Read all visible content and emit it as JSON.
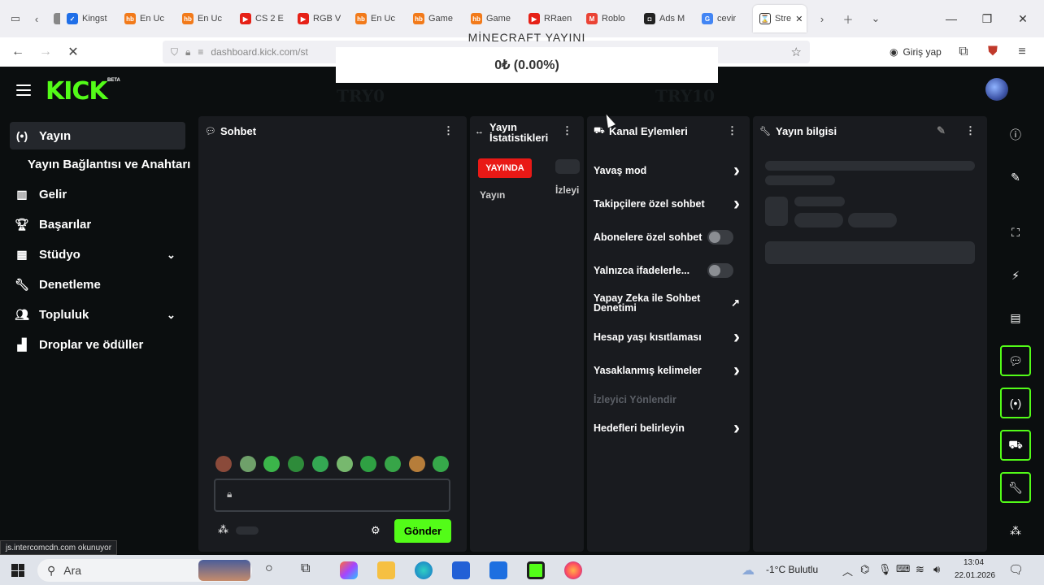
{
  "browser": {
    "tabs": [
      {
        "label": "",
        "fav_color": "#888",
        "fav_text": ""
      },
      {
        "label": "Kingst",
        "fav_color": "#1f6fe8",
        "fav_text": "✓"
      },
      {
        "label": "En Uc",
        "fav_color": "#f27a1a",
        "fav_text": "hb"
      },
      {
        "label": "En Uc",
        "fav_color": "#f27a1a",
        "fav_text": "hb"
      },
      {
        "label": "CS 2 E",
        "fav_color": "#e62117",
        "fav_text": "▶"
      },
      {
        "label": "RGB V",
        "fav_color": "#e62117",
        "fav_text": "▶"
      },
      {
        "label": "En Uc",
        "fav_color": "#f27a1a",
        "fav_text": "hb"
      },
      {
        "label": "Game",
        "fav_color": "#f27a1a",
        "fav_text": "hb"
      },
      {
        "label": "Game",
        "fav_color": "#f27a1a",
        "fav_text": "hb"
      },
      {
        "label": "RRaen",
        "fav_color": "#e62117",
        "fav_text": "▶"
      },
      {
        "label": "Roblo",
        "fav_color": "#ea4335",
        "fav_text": "M"
      },
      {
        "label": "Ads M",
        "fav_color": "#222",
        "fav_text": "◘"
      },
      {
        "label": "cevir",
        "fav_color": "#4285f4",
        "fav_text": "G"
      }
    ],
    "active_tab": "Stre",
    "url": "dashboard.kick.com/st",
    "login_label": "Giriş yap"
  },
  "overlay": {
    "title": "MİNECRAFT YAYINI",
    "amount": "0₺ (0.00%)",
    "left_label": "TRY0",
    "right_label": "TRY10"
  },
  "kick": {
    "logo": "KICK",
    "beta": "BETA"
  },
  "sidebar": {
    "items": [
      {
        "label": "Yayın",
        "icon": "broadcast-icon"
      },
      {
        "label": "Yayın Bağlantısı ve Anahtarı"
      },
      {
        "label": "Gelir",
        "icon": "chart-icon"
      },
      {
        "label": "Başarılar",
        "icon": "trophy-icon"
      },
      {
        "label": "Stüdyo",
        "icon": "studio-icon"
      },
      {
        "label": "Denetleme",
        "icon": "wrench-icon"
      },
      {
        "label": "Topluluk",
        "icon": "community-icon"
      },
      {
        "label": "Droplar ve ödüller",
        "icon": "drops-icon"
      }
    ]
  },
  "chat": {
    "title": "Sohbet",
    "send_label": "Gönder",
    "emote_colors": [
      "#8a4a3a",
      "#6fa06a",
      "#3bb54a",
      "#2e8b3a",
      "#34a853",
      "#77b86e",
      "#2fa043",
      "#37a548",
      "#b67d3a",
      "#36a84a"
    ]
  },
  "stats": {
    "title_line1": "Yayın",
    "title_line2": "İstatistikleri",
    "live_badge": "YAYINDA",
    "label_stream": "Yayın",
    "label_viewers": "İzleyi"
  },
  "actions": {
    "title": "Kanal Eylemleri",
    "items": [
      {
        "label": "Yavaş mod",
        "control": "chevron"
      },
      {
        "label": "Takipçilere özel sohbet",
        "control": "chevron"
      },
      {
        "label": "Abonelere özel sohbet",
        "control": "toggle"
      },
      {
        "label": "Yalnızca ifadelerle...",
        "control": "toggle"
      },
      {
        "label": "Yapay Zeka ile Sohbet Denetimi",
        "control": "external"
      },
      {
        "label": "Hesap yaşı kısıtlaması",
        "control": "chevron"
      },
      {
        "label": "Yasaklanmış kelimeler",
        "control": "chevron"
      },
      {
        "label": "İzleyici Yönlendir",
        "control": "disabled"
      },
      {
        "label": "Hedefleri belirleyin",
        "control": "chevron"
      }
    ]
  },
  "info": {
    "title": "Yayın bilgisi"
  },
  "status_url": "js.intercomcdn.com okunuyor",
  "taskbar": {
    "search_placeholder": "Ara",
    "weather": "-1°C  Bulutlu",
    "time": "13:04",
    "date": "22.01.2026"
  },
  "colors": {
    "accent": "#53fc18",
    "live": "#e91916",
    "panel": "#191b1f",
    "background": "#0b0e0f"
  }
}
